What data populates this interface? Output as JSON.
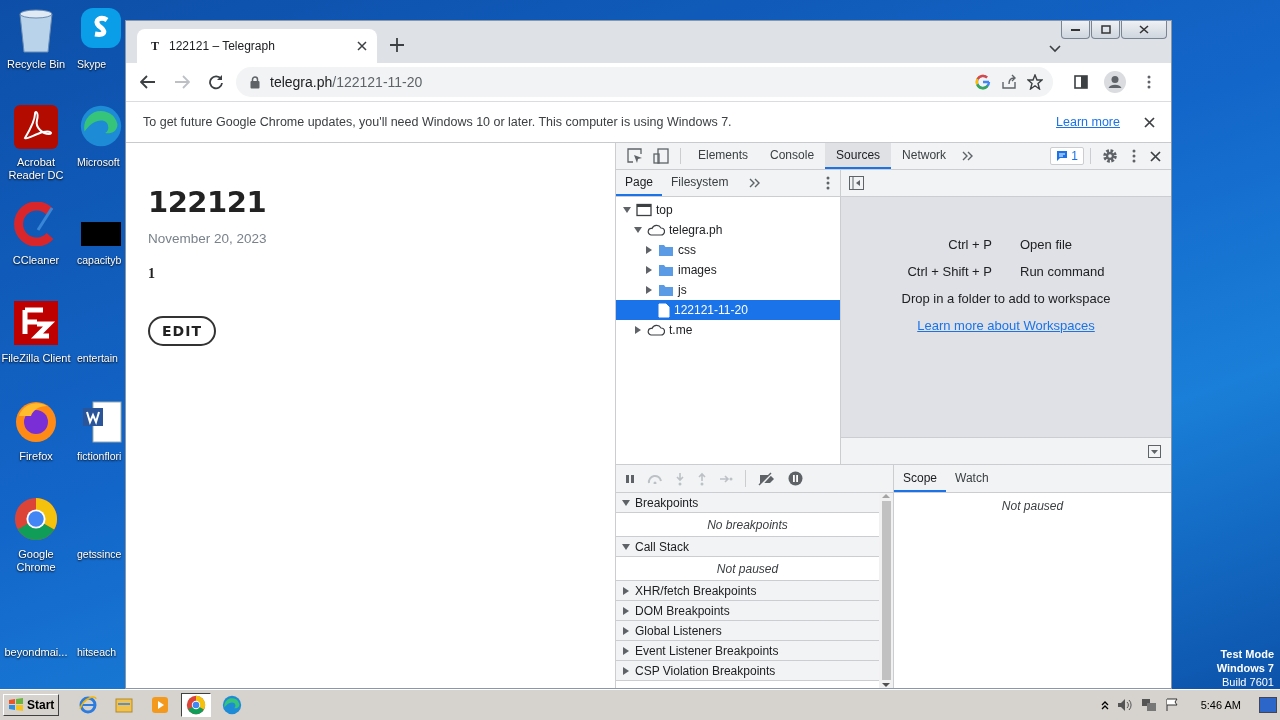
{
  "desktop": {
    "icons": [
      {
        "label": "Recycle Bin",
        "kind": "recycle"
      },
      {
        "label": "Skype",
        "kind": "skype"
      },
      {
        "label": "Acrobat Reader DC",
        "kind": "acrobat"
      },
      {
        "label": "Microsoft",
        "kind": "edge"
      },
      {
        "label": "CCleaner",
        "kind": "ccleaner"
      },
      {
        "label": "capacityb",
        "kind": "blackbox"
      },
      {
        "label": "FileZilla Client",
        "kind": "filezilla"
      },
      {
        "label": "entertain",
        "kind": "blank"
      },
      {
        "label": "Firefox",
        "kind": "firefox"
      },
      {
        "label": "fictionflori",
        "kind": "word"
      },
      {
        "label": "Google Chrome",
        "kind": "chrome"
      },
      {
        "label": "getssince",
        "kind": "blank"
      },
      {
        "label": "beyondmai...",
        "kind": "blank"
      },
      {
        "label": "hitseach",
        "kind": "blank"
      }
    ],
    "os_notice": [
      "Test Mode",
      "Windows 7",
      "Build 7601"
    ]
  },
  "browser": {
    "tab": {
      "favicon": "T",
      "title": "122121 – Telegraph"
    },
    "address": {
      "host": "telegra.ph",
      "path": "/122121-11-20"
    },
    "infobar": {
      "message": "To get future Google Chrome updates, you'll need Windows 10 or later. This computer is using Windows 7.",
      "link": "Learn more"
    },
    "page": {
      "title": "122121",
      "date": "November 20, 2023",
      "body": "1",
      "edit_button": "EDIT"
    }
  },
  "devtools": {
    "tabs": [
      {
        "label": "Elements",
        "selected": false
      },
      {
        "label": "Console",
        "selected": false
      },
      {
        "label": "Sources",
        "selected": true
      },
      {
        "label": "Network",
        "selected": false
      }
    ],
    "issues_count": "1",
    "navigator_tabs": [
      {
        "label": "Page",
        "selected": true
      },
      {
        "label": "Filesystem",
        "selected": false
      }
    ],
    "tree": [
      {
        "label": "top",
        "kind": "frame",
        "expanded": true,
        "selected": false,
        "children": [
          {
            "label": "telegra.ph",
            "kind": "origin",
            "expanded": true,
            "selected": false,
            "children": [
              {
                "label": "css",
                "kind": "folder",
                "expanded": false,
                "selected": false
              },
              {
                "label": "images",
                "kind": "folder",
                "expanded": false,
                "selected": false
              },
              {
                "label": "js",
                "kind": "folder",
                "expanded": false,
                "selected": false
              },
              {
                "label": "122121-11-20",
                "kind": "file",
                "selected": true
              }
            ]
          },
          {
            "label": "t.me",
            "kind": "origin",
            "expanded": false,
            "selected": false
          }
        ]
      }
    ],
    "shortcuts": [
      {
        "keys": "Ctrl + P",
        "action": "Open file"
      },
      {
        "keys": "Ctrl + Shift + P",
        "action": "Run command"
      }
    ],
    "drop_hint": "Drop in a folder to add to workspace",
    "workspaces_link": "Learn more about Workspaces",
    "panes": [
      {
        "title": "Breakpoints",
        "expanded": true,
        "empty_text": "No breakpoints"
      },
      {
        "title": "Call Stack",
        "expanded": true,
        "empty_text": "Not paused"
      },
      {
        "title": "XHR/fetch Breakpoints",
        "expanded": false
      },
      {
        "title": "DOM Breakpoints",
        "expanded": false
      },
      {
        "title": "Global Listeners",
        "expanded": false
      },
      {
        "title": "Event Listener Breakpoints",
        "expanded": false
      },
      {
        "title": "CSP Violation Breakpoints",
        "expanded": false
      }
    ],
    "scope_tabs": [
      {
        "label": "Scope",
        "selected": true
      },
      {
        "label": "Watch",
        "selected": false
      }
    ],
    "scope_empty": "Not paused"
  },
  "taskbar": {
    "start": "Start",
    "items": [
      {
        "kind": "ie",
        "selected": false
      },
      {
        "kind": "explorer",
        "selected": false
      },
      {
        "kind": "media",
        "selected": false
      },
      {
        "kind": "chrome",
        "selected": true
      },
      {
        "kind": "edge",
        "selected": false
      }
    ],
    "time": "5:46 AM"
  }
}
